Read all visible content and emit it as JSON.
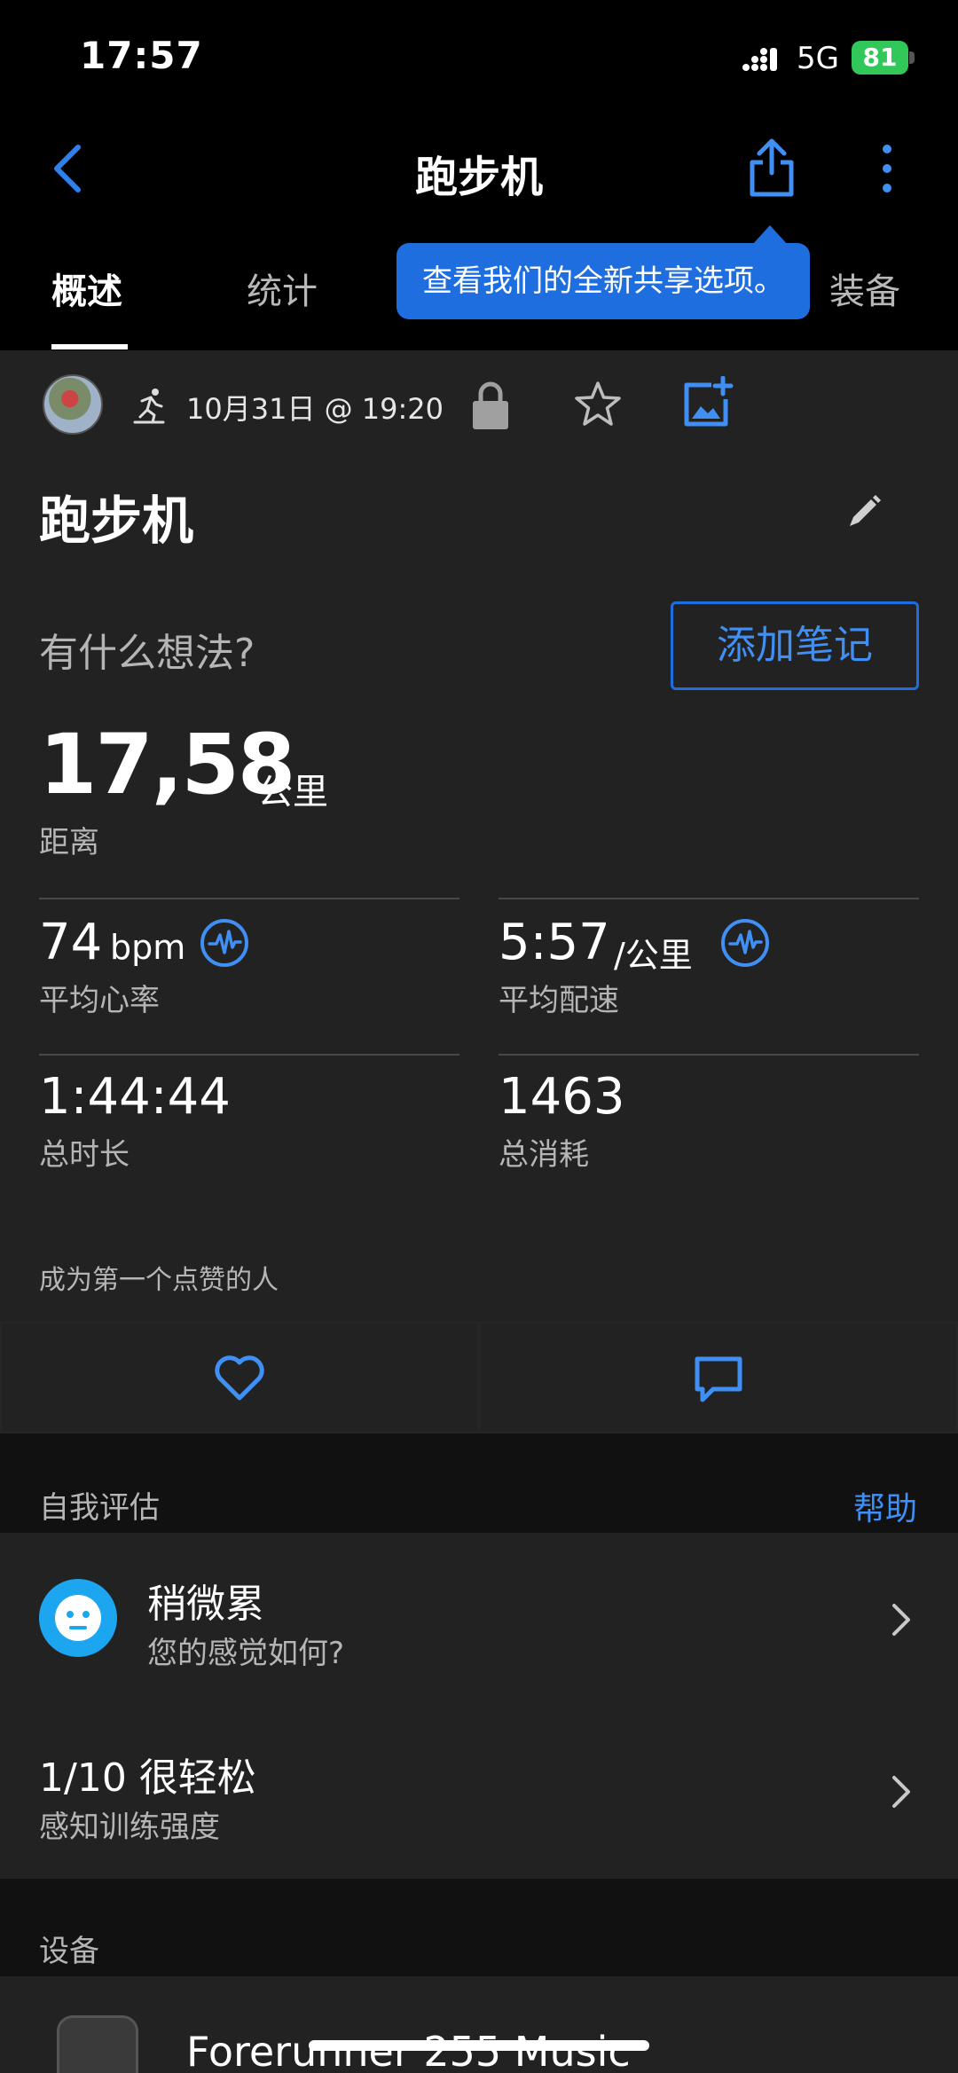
{
  "status_bar": {
    "time": "17:57",
    "network": "5G",
    "battery": "81"
  },
  "nav": {
    "title": "跑步机"
  },
  "tabs": [
    {
      "label": "概述",
      "active": true
    },
    {
      "label": "统计",
      "active": false
    },
    {
      "label": "装备",
      "active": false
    }
  ],
  "tooltip": {
    "text": "查看我们的全新共享选项。"
  },
  "activity": {
    "date": "10月31日 @ 19:20",
    "title": "跑步机",
    "thoughts_prompt": "有什么想法?",
    "add_note_label": "添加笔记"
  },
  "distance": {
    "value": "17,58",
    "unit": "公里",
    "label": "距离"
  },
  "stats": {
    "heart_rate": {
      "value": "74",
      "unit": "bpm",
      "label": "平均心率"
    },
    "pace": {
      "value": "5:57",
      "unit": "/公里",
      "label": "平均配速"
    },
    "duration": {
      "value": "1:44:44",
      "label": "总时长"
    },
    "calories": {
      "value": "1463",
      "label": "总消耗"
    }
  },
  "likes_text": "成为第一个点赞的人",
  "self_eval": {
    "section_title": "自我评估",
    "help_label": "帮助",
    "feeling": {
      "title": "稍微累",
      "subtitle": "您的感觉如何?"
    },
    "rpe": {
      "title": "1/10 很轻松",
      "subtitle": "感知训练强度"
    }
  },
  "devices": {
    "section_title": "设备",
    "device_name": "Forerunner 255 Music"
  },
  "colors": {
    "accent": "#1e6ee0",
    "link": "#3f8ff5",
    "face": "#1da6f0",
    "battery": "#32c759"
  }
}
